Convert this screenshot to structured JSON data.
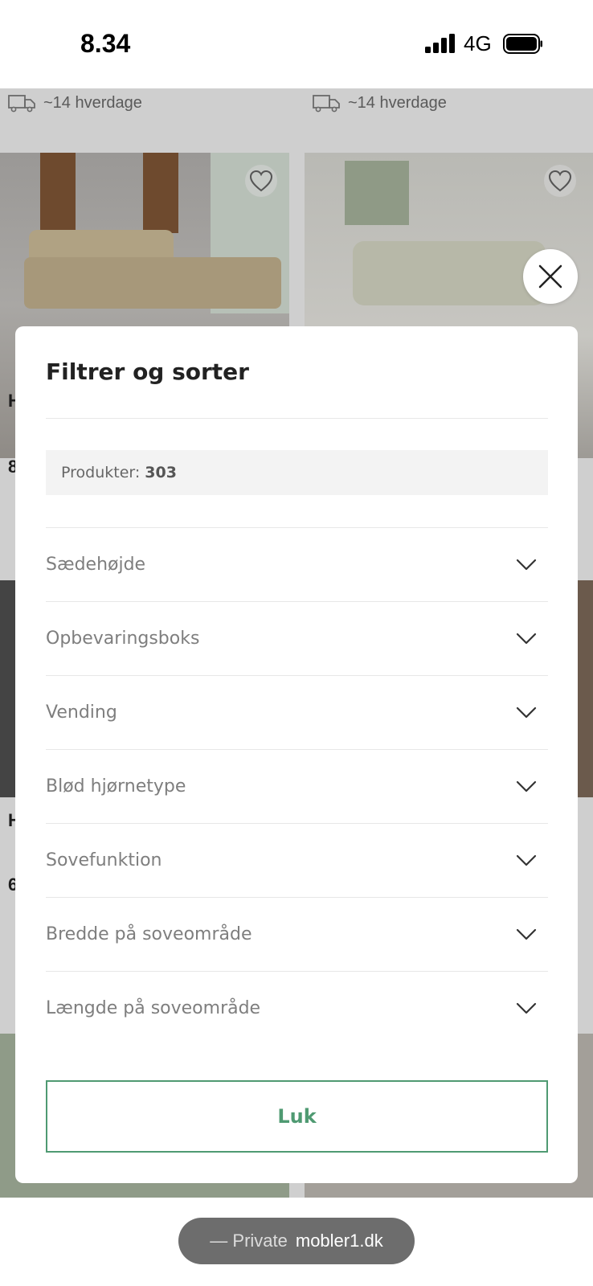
{
  "status_bar": {
    "time": "8.34",
    "network": "4G"
  },
  "background": {
    "delivery_left": "~14 hverdage",
    "delivery_right": "~14 hverdage",
    "letters": [
      "H",
      "8",
      "H",
      "6"
    ]
  },
  "modal": {
    "title": "Filtrer og sorter",
    "products_label": "Produkter:",
    "products_count": "303",
    "filters": [
      {
        "label": "Sædehøjde"
      },
      {
        "label": "Opbevaringsboks"
      },
      {
        "label": "Vending"
      },
      {
        "label": "Blød hjørnetype"
      },
      {
        "label": "Sovefunktion"
      },
      {
        "label": "Bredde på soveområde"
      },
      {
        "label": "Længde på soveområde"
      }
    ],
    "close_label": "Luk"
  },
  "browser": {
    "private_label": "— Private",
    "domain": "mobler1.dk"
  },
  "colors": {
    "accent": "#4f9a72",
    "overlay": "#cfcfcf"
  },
  "icons": [
    "truck-icon",
    "heart-icon",
    "close-icon",
    "chevron-down-icon",
    "signal-icon",
    "battery-icon"
  ]
}
